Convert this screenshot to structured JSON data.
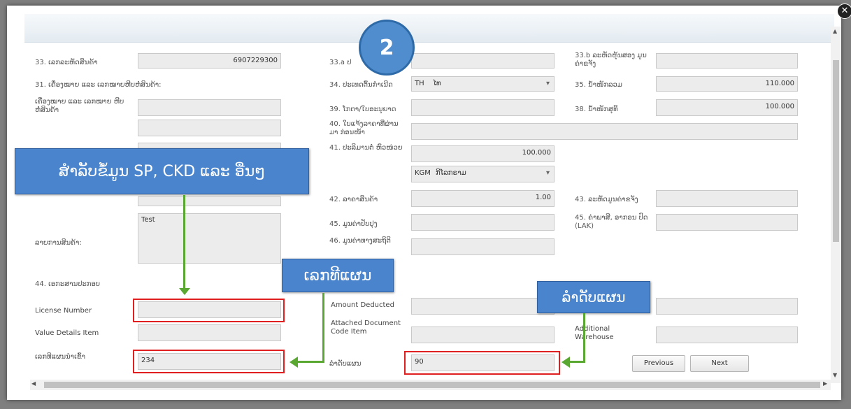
{
  "fields": {
    "f33_label": "33. ເລກລະຫັດສິນຄ້າ",
    "f33_value": "6907229300",
    "f33a_label": "33.a ປ",
    "f33b_label": "33.b ລະຫັດຫຸ້ນສອງ ມູນຄ່າຂຈັງ",
    "f31_label": "31. ເຄື່ອງໝາຍ ແລະ ເລກໝາຍຫີບຫໍ່ສິນຄ້າ:",
    "f31_sub_label": "ເຄື່ອງໝາຍ ແລະ ເລກໝາຍ ຫີບຫໍ່ສິນຄ້າ",
    "f34_label": "34. ປະເທດຕົ້ນກໍາເນີດ",
    "f34_code": "TH",
    "f34_value": "ໄທ",
    "f35_label": "35. ນໍ້າໜັກລວມ",
    "f35_value": "110.000",
    "f39_label": "39. ໂກຕາ/ໃບອະນຸຍາດ",
    "f38_label": "38. ນໍ້າໜັກສຸທິ",
    "f38_value": "100.000",
    "f40_label": "40. ໃບແຈ້ງລາຄາທີ່ຜ່ານມາ ກ່ອນໜ້າ",
    "f41_label": "41. ປະລິມານຕໍ່ ຫົວໜ່ວຍ",
    "f41_value": "100.000",
    "f41_unit_code": "KGM",
    "f41_unit_value": "ກິໂລກຣາມ",
    "f42_label": "42. ລາຄາສິນຄ້າ",
    "f42_value": "1.00",
    "f43_label": "43. ລະຫັດມູນຄ່າຂຈັງ",
    "f45_label": "45. ມູນຄ່າປັບປຸງ",
    "f45b_label": "45. ຄ່າພາສີ, ອາກອນ ປົດ (LAK)",
    "f46_label": "46. ມູນຄ່າທາງສະຖິຕິ",
    "desc_label": "ລາຍການສິນຄ້າ:",
    "desc_value": "Test",
    "f44_label": "44. ເອກະສານປະກອບ",
    "license_label": "License Number",
    "value_details_label": "Value Details Item",
    "plan_number_label": "ເລກທີແຜນນໍາເຂົ້າ",
    "plan_number_value": "234",
    "amount_deducted_label": "Amount Deducted",
    "attached_doc_label": "Attached Document Code Item",
    "plan_order_label": "ລໍາດັບແຜນ",
    "plan_order_value": "90",
    "additional_warehouse_label": "Additional Warehouse"
  },
  "buttons": {
    "previous": "Previous",
    "next": "Next"
  },
  "annotations": {
    "step_number": "2",
    "callout_sp_ckd": "ສໍາລັບຂໍ້ມູນ SP, CKD ແລະ ອື່ນໆ",
    "callout_plan_number": "ເລກທີແຜນ",
    "callout_plan_order": "ລໍາດັບແຜນ",
    "annotation_color": "#4a84cc",
    "highlight_color": "#e02020",
    "arrow_color": "#5aa832"
  }
}
